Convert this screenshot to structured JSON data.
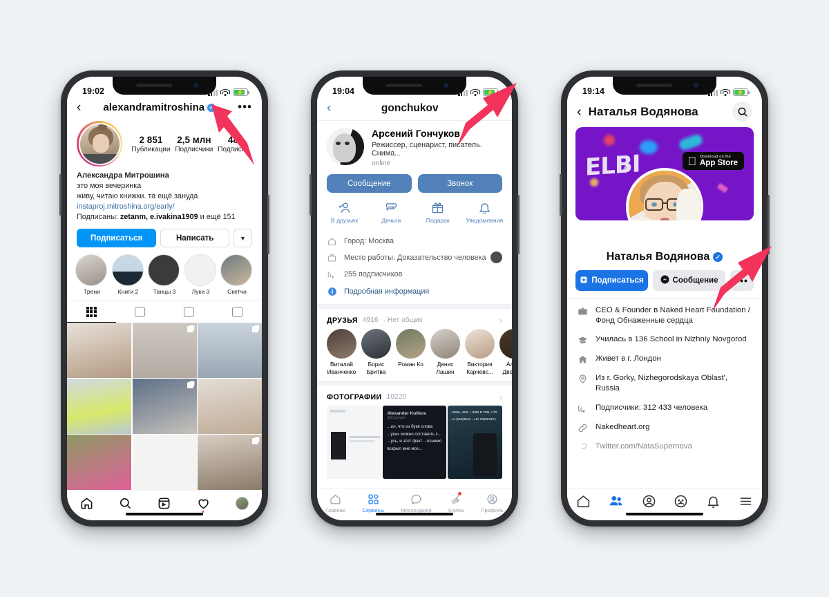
{
  "background_color": "#eef2f4",
  "annotation_color": "#f2335c",
  "phones": [
    {
      "app": "instagram",
      "status": {
        "time": "19:02",
        "wifi_icon": "wifi-icon",
        "battery_icon": "battery-charging-icon",
        "signal_icon": "cellular-signal-icon"
      },
      "topbar": {
        "back_icon": "back-chevron-icon",
        "handle": "alexandramitroshina",
        "verified_icon": "verified-badge-icon",
        "more_icon": "more-options-icon"
      },
      "stats": [
        {
          "num": "2 851",
          "label": "Публикации"
        },
        {
          "num": "2,5 млн",
          "label": "Подписчики"
        },
        {
          "num": "48",
          "label": "Подписки"
        }
      ],
      "bio": {
        "name": "Александра Митрошина",
        "line1": "это моя вечеринка",
        "line2": "живу, читаю книжки. та ещё зануда",
        "link": "instaproj.mitroshina.org/early/",
        "followed_prefix": "Подписаны: ",
        "followed_names": "zetanm, e.ivakina1909",
        "followed_suffix": " и ещё 151"
      },
      "actions": {
        "follow": "Подписаться",
        "message": "Написать",
        "caret_icon": "chevron-down-icon"
      },
      "highlights": [
        {
          "label": "Трени"
        },
        {
          "label": "Книги 2"
        },
        {
          "label": "Танцы 3"
        },
        {
          "label": "Луки 3"
        },
        {
          "label": "Скетчи"
        }
      ],
      "tabs": [
        {
          "icon": "grid-icon",
          "active": true
        },
        {
          "icon": "reels-icon",
          "active": false
        },
        {
          "icon": "guides-icon",
          "active": false
        },
        {
          "icon": "tagged-icon",
          "active": false
        }
      ],
      "bottom_nav": [
        {
          "icon": "home-icon"
        },
        {
          "icon": "search-icon"
        },
        {
          "icon": "reels-icon"
        },
        {
          "icon": "heart-icon"
        },
        {
          "icon": "profile-avatar-icon"
        }
      ]
    },
    {
      "app": "vk",
      "status": {
        "time": "19:04",
        "wifi_icon": "wifi-icon",
        "battery_icon": "battery-charging-icon",
        "signal_icon": "cellular-signal-icon"
      },
      "topbar": {
        "back_icon": "back-chevron-icon",
        "title": "gonchukov",
        "more_icon": "more-options-icon"
      },
      "profile": {
        "name": "Арсений Гончуков",
        "verified_icon": "verified-check-icon",
        "status": "Режиссер, сценарист, писатель. Снима...",
        "online": "online"
      },
      "actions": {
        "message": "Сообщение",
        "call": "Звонок"
      },
      "quick_actions": [
        {
          "icon": "friend-check-icon",
          "label": "В друзьях"
        },
        {
          "icon": "money-icon",
          "label": "Деньги"
        },
        {
          "icon": "gift-icon",
          "label": "Подарок"
        },
        {
          "icon": "bell-icon",
          "label": "Уведомления"
        }
      ],
      "info_rows": [
        {
          "icon": "home-icon",
          "text": "Город: Москва"
        },
        {
          "icon": "briefcase-icon",
          "text": "Место работы: Доказательство человека",
          "thumb": true
        },
        {
          "icon": "rss-icon",
          "text": "255 подписчиков"
        },
        {
          "icon": "info-icon",
          "text": "Подробная информация",
          "link": true
        }
      ],
      "friends_section": {
        "title": "ДРУЗЬЯ",
        "count": "4916",
        "note": "· Нет общих",
        "arrow_icon": "chevron-right-icon"
      },
      "friends": [
        {
          "name": "Виталий Иванченко"
        },
        {
          "name": "Борис Бритва"
        },
        {
          "name": "Роман Ко"
        },
        {
          "name": "Денис Лашин"
        },
        {
          "name": "Виктория Карчевс..."
        },
        {
          "name": "Алекс Двоегл..."
        }
      ],
      "photos_section": {
        "title": "ФОТОГРАФИИ",
        "count": "10220",
        "arrow_icon": "chevron-right-icon"
      },
      "photo_texts": {
        "p2_author": "Alexander Kulikov",
        "p2_handle": "@Cuzvach",
        "p2_body": "...ил, что из букв слова ...ука» можно составить с... ...усь, и этот факт ...яснимо вскрыл мне моз...",
        "p3_body": "...вать, вся ...ема в том, что ...ы разумна ...не охраняет,"
      },
      "bottom_nav": [
        {
          "icon": "home-icon",
          "label": "Главная",
          "active": false
        },
        {
          "icon": "services-grid-icon",
          "label": "Сервисы",
          "active": true
        },
        {
          "icon": "messenger-bubble-icon",
          "label": "Мессенджер",
          "active": false
        },
        {
          "icon": "clips-icon",
          "label": "Клипы",
          "active": false,
          "badge": true
        },
        {
          "icon": "profile-icon",
          "label": "Профиль",
          "active": false
        }
      ]
    },
    {
      "app": "facebook",
      "status": {
        "time": "19:14",
        "wifi_icon": "wifi-icon",
        "battery_icon": "battery-charging-icon",
        "signal_icon": "cellular-signal-icon"
      },
      "topbar": {
        "back_icon": "back-chevron-icon",
        "title": "Наталья Водянова",
        "search_icon": "search-icon"
      },
      "cover": {
        "brand_text": "ELBI",
        "appstore_small": "Download on the",
        "appstore_big": "App Store",
        "apple_icon": "apple-logo-icon",
        "background_color": "#7615c8"
      },
      "profile": {
        "name": "Наталья Водянова",
        "verified_icon": "verified-badge-icon"
      },
      "actions": {
        "follow": "Подписаться",
        "follow_icon": "follow-plus-icon",
        "message": "Сообщение",
        "message_icon": "messenger-icon",
        "more_icon": "more-options-icon"
      },
      "info_rows": [
        {
          "icon": "briefcase-icon",
          "text": "CEO & Founder в Naked Heart Foundation / Фонд Обнаженные сердца"
        },
        {
          "icon": "graduation-cap-icon",
          "text": "Училась в 136 School in Nizhniy Novgorod"
        },
        {
          "icon": "house-icon",
          "text": "Живет в г. Лондон"
        },
        {
          "icon": "location-pin-icon",
          "text": "Из г. Gorky, Nizhegorodskaya Oblast', Russia"
        },
        {
          "icon": "rss-icon",
          "text": "Подписчики: 312 433 человека"
        },
        {
          "icon": "link-icon",
          "text": "Nakedheart.org"
        },
        {
          "icon": "link-icon",
          "text": "Twitter.com/NataSupernova",
          "cut": true
        }
      ],
      "bottom_nav": [
        {
          "icon": "home-icon",
          "active": false
        },
        {
          "icon": "friends-icon",
          "active": true
        },
        {
          "icon": "profile-circle-icon",
          "active": false
        },
        {
          "icon": "groups-icon",
          "active": false
        },
        {
          "icon": "bell-icon",
          "active": false
        },
        {
          "icon": "menu-hamburger-icon",
          "active": false
        }
      ]
    }
  ]
}
